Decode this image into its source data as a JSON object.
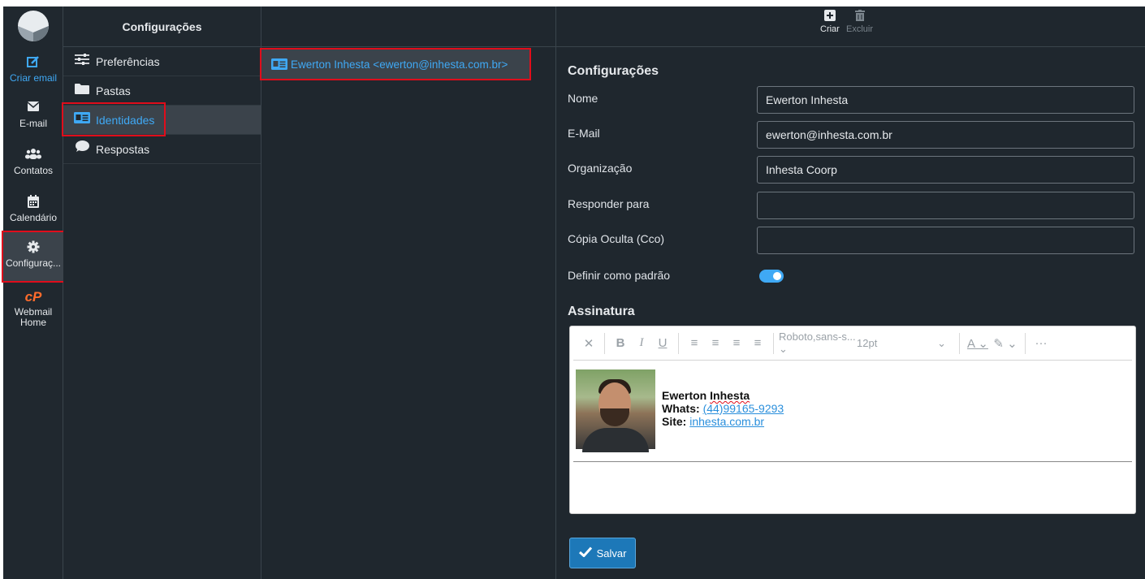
{
  "rail": {
    "items": [
      {
        "label": "Criar email",
        "icon": "compose-icon"
      },
      {
        "label": "E-mail",
        "icon": "envelope-icon"
      },
      {
        "label": "Contatos",
        "icon": "users-icon"
      },
      {
        "label": "Calendário",
        "icon": "calendar-icon"
      },
      {
        "label": "Configuraç...",
        "icon": "gear-icon"
      },
      {
        "label": "Webmail Home",
        "icon": "cpanel-icon"
      }
    ]
  },
  "settings_menu": {
    "title": "Configurações",
    "items": [
      {
        "label": "Preferências",
        "icon": "sliders-icon"
      },
      {
        "label": "Pastas",
        "icon": "folder-icon"
      },
      {
        "label": "Identidades",
        "icon": "id-card-icon"
      },
      {
        "label": "Respostas",
        "icon": "speech-bubble-icon"
      }
    ]
  },
  "identities": {
    "items": [
      {
        "label": "Ewerton Inhesta <ewerton@inhesta.com.br>",
        "icon": "id-card-icon"
      }
    ]
  },
  "toolbar": {
    "create_label": "Criar",
    "delete_label": "Excluir"
  },
  "form": {
    "section_title": "Configurações",
    "name_label": "Nome",
    "name_value": "Ewerton Inhesta",
    "email_label": "E-Mail",
    "email_value": "ewerton@inhesta.com.br",
    "org_label": "Organização",
    "org_value": "Inhesta Coorp",
    "reply_label": "Responder para",
    "reply_value": "",
    "bcc_label": "Cópia Oculta (Cco)",
    "bcc_value": "",
    "default_label": "Definir como padrão",
    "default_on": true
  },
  "signature": {
    "section_title": "Assinatura",
    "font": "Roboto,sans-s...",
    "size": "12pt",
    "name": "Ewerton Inhesta",
    "name_first": "Ewerton",
    "name_last": "Inhesta",
    "whats_label": "Whats:",
    "whats_value": "(44)99165-9293",
    "site_label": "Site:",
    "site_value": "inhesta.com.br"
  },
  "save_label": "Salvar",
  "colors": {
    "accent": "#3fa9f5",
    "highlight": "#e00d1b",
    "background": "#1f272e",
    "save_button": "#1d78b8"
  }
}
